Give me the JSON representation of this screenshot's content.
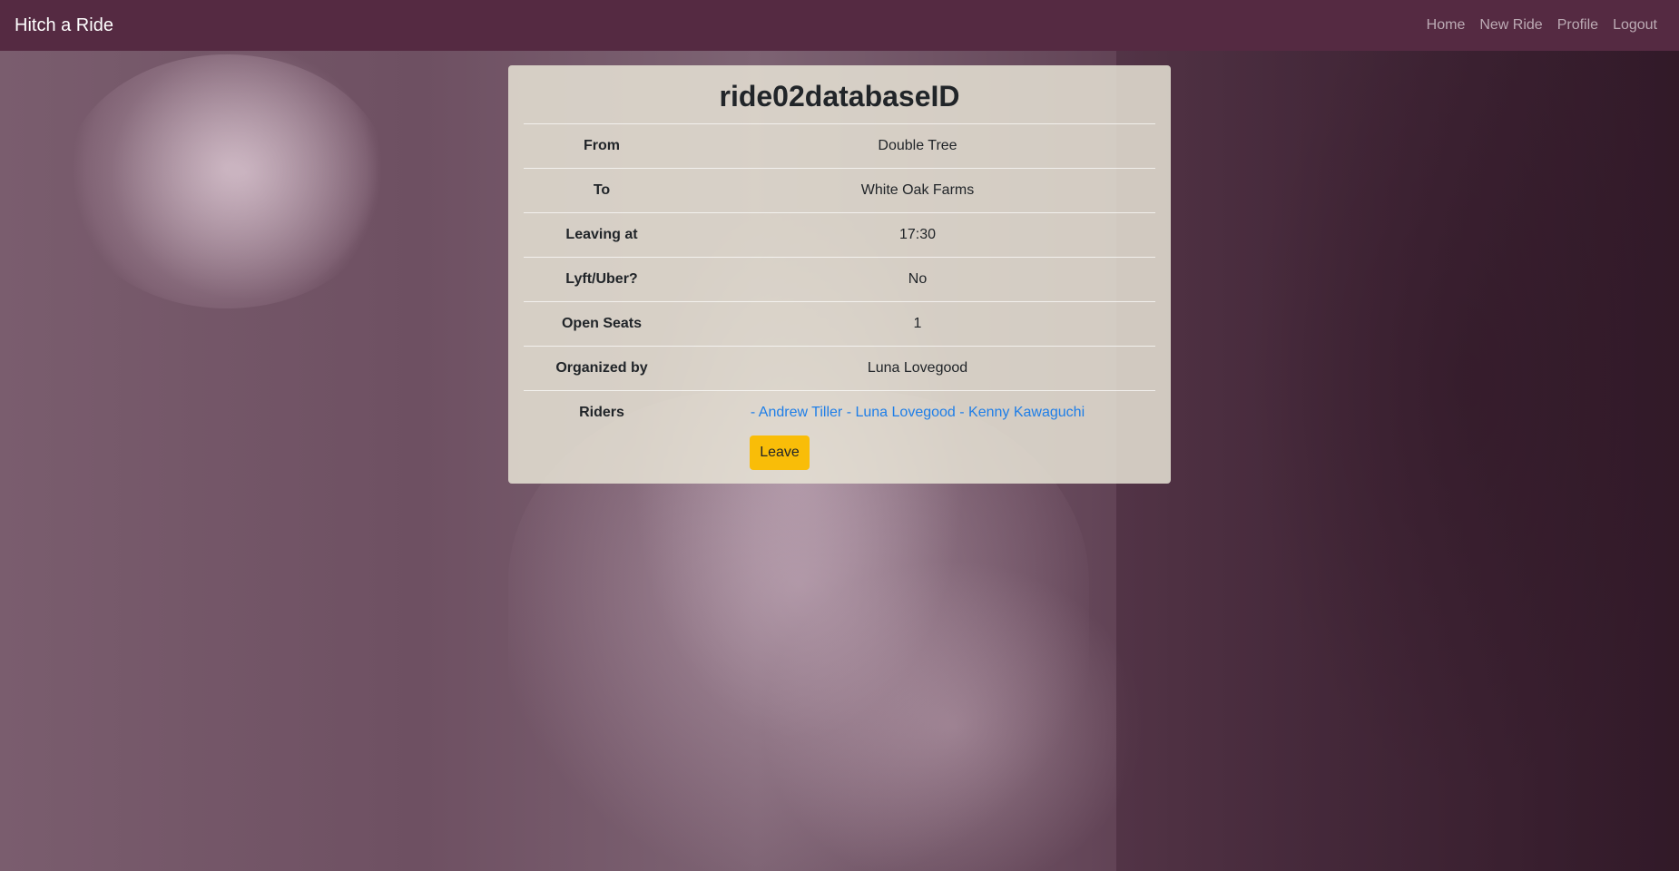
{
  "navbar": {
    "brand": "Hitch a Ride",
    "links": [
      "Home",
      "New Ride",
      "Profile",
      "Logout"
    ]
  },
  "ride": {
    "title": "ride02databaseID",
    "rows": [
      {
        "label": "From",
        "value": "Double Tree"
      },
      {
        "label": "To",
        "value": "White Oak Farms"
      },
      {
        "label": "Leaving at",
        "value": "17:30"
      },
      {
        "label": "Lyft/Uber?",
        "value": "No"
      },
      {
        "label": "Open Seats",
        "value": "1"
      },
      {
        "label": "Organized by",
        "value": "Luna Lovegood"
      }
    ],
    "riders_label": "Riders",
    "riders": [
      "- Andrew Tiller",
      "- Luna Lovegood",
      "- Kenny Kawaguchi"
    ],
    "leave_label": "Leave"
  },
  "colors": {
    "navbar": "#552a42",
    "accent_button": "#f9bd08",
    "link": "#1e7ee8"
  }
}
